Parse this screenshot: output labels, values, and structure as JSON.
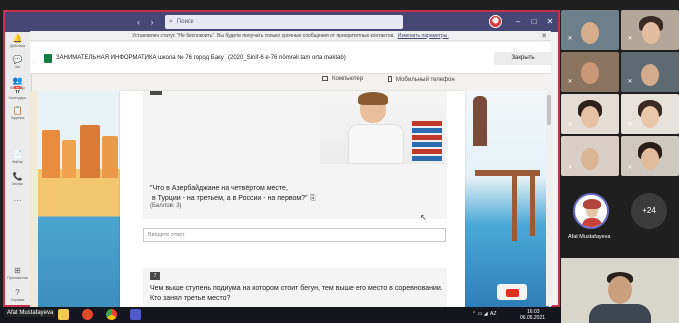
{
  "window": {
    "search_placeholder": "Поиск",
    "minimize": "–",
    "maximize": "□",
    "close": "✕"
  },
  "rail": [
    {
      "icon": "bell-icon",
      "glyph": "🔔",
      "label": "Действия"
    },
    {
      "icon": "chat-icon",
      "glyph": "💬",
      "label": "Чат"
    },
    {
      "icon": "teams-icon",
      "glyph": "👥",
      "label": "Команды"
    },
    {
      "icon": "assignments-icon",
      "glyph": "📋",
      "label": "Задания"
    },
    {
      "icon": "calendar-icon",
      "glyph": "📅",
      "label": "Календарь"
    },
    {
      "icon": "calls-icon",
      "glyph": "📞",
      "label": "Звонки"
    },
    {
      "icon": "files-icon",
      "glyph": "📄",
      "label": "Файлы"
    },
    {
      "icon": "more-icon",
      "glyph": "···",
      "label": ""
    },
    {
      "icon": "apps-icon",
      "glyph": "⊞",
      "label": "Приложения"
    },
    {
      "icon": "help-icon",
      "glyph": "?",
      "label": "Справка"
    }
  ],
  "banner": {
    "text": "Установлен статус \"Не беспокоить\". Вы будете получать только срочные сообщения от приоритетных контактов.",
    "link": "Изменить параметры.",
    "close": "✕"
  },
  "header": {
    "app_name": "ЗАНИМАТЕЛЬНАЯ ИНФОРМАТИКА",
    "school": "школа № 76 город Баку",
    "class_name": "(2020_Sinif-6 e-76 nömrəli tam orta məktəb)",
    "close_button": "Закрыть"
  },
  "view_options": {
    "computer": "Компьютер",
    "mobile": "Мобильный телефон"
  },
  "form": {
    "q6_text": "\"Что в Азербайджане на четвёртом месте,\n в Турции - на третьем, а в России - на первом?\"",
    "q6_points": "(Баллов: 3)",
    "answer_placeholder": "Введите ответ",
    "q7_number": "7",
    "q7_text": "Чем выше ступень подиума на котором стоит бегун, тем выше его место в соревновании.\nКто занял третье место?"
  },
  "participants": {
    "presenter_name": "Afat Mustafayeva",
    "more_count": "+24"
  },
  "taskbar": {
    "user_tag": "Afat Mustafayeva",
    "lang": "AZ",
    "time": "16:03",
    "date": "06.05.2021"
  },
  "colors": {
    "teams_purple": "#464775",
    "active_border": "#c4314b",
    "excel_green": "#107c41"
  }
}
